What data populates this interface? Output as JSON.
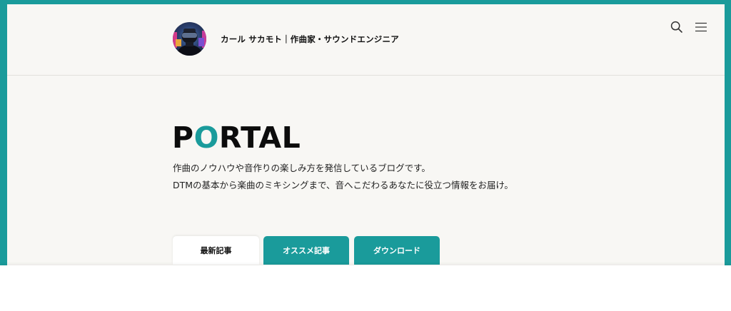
{
  "header": {
    "site_title": "カール サカモト｜作曲家・サウンドエンジニア",
    "icons": [
      "search-icon",
      "hamburger-menu-icon"
    ]
  },
  "hero": {
    "logo_first": "P",
    "logo_accent": "O",
    "logo_rest": "RTAL",
    "description_line1": "作曲のノウハウや音作りの楽しみ方を発信しているブログです。",
    "description_line2": "DTMの基本から楽曲のミキシングまで、音へこだわるあなたに役立つ情報をお届け。"
  },
  "tabs": [
    {
      "label": "最新記事",
      "active": true
    },
    {
      "label": "オススメ記事",
      "active": false
    },
    {
      "label": "ダウンロード",
      "active": false
    }
  ],
  "colors": {
    "accent": "#1a9b9b",
    "background": "#f8f7f4",
    "text": "#111111"
  }
}
